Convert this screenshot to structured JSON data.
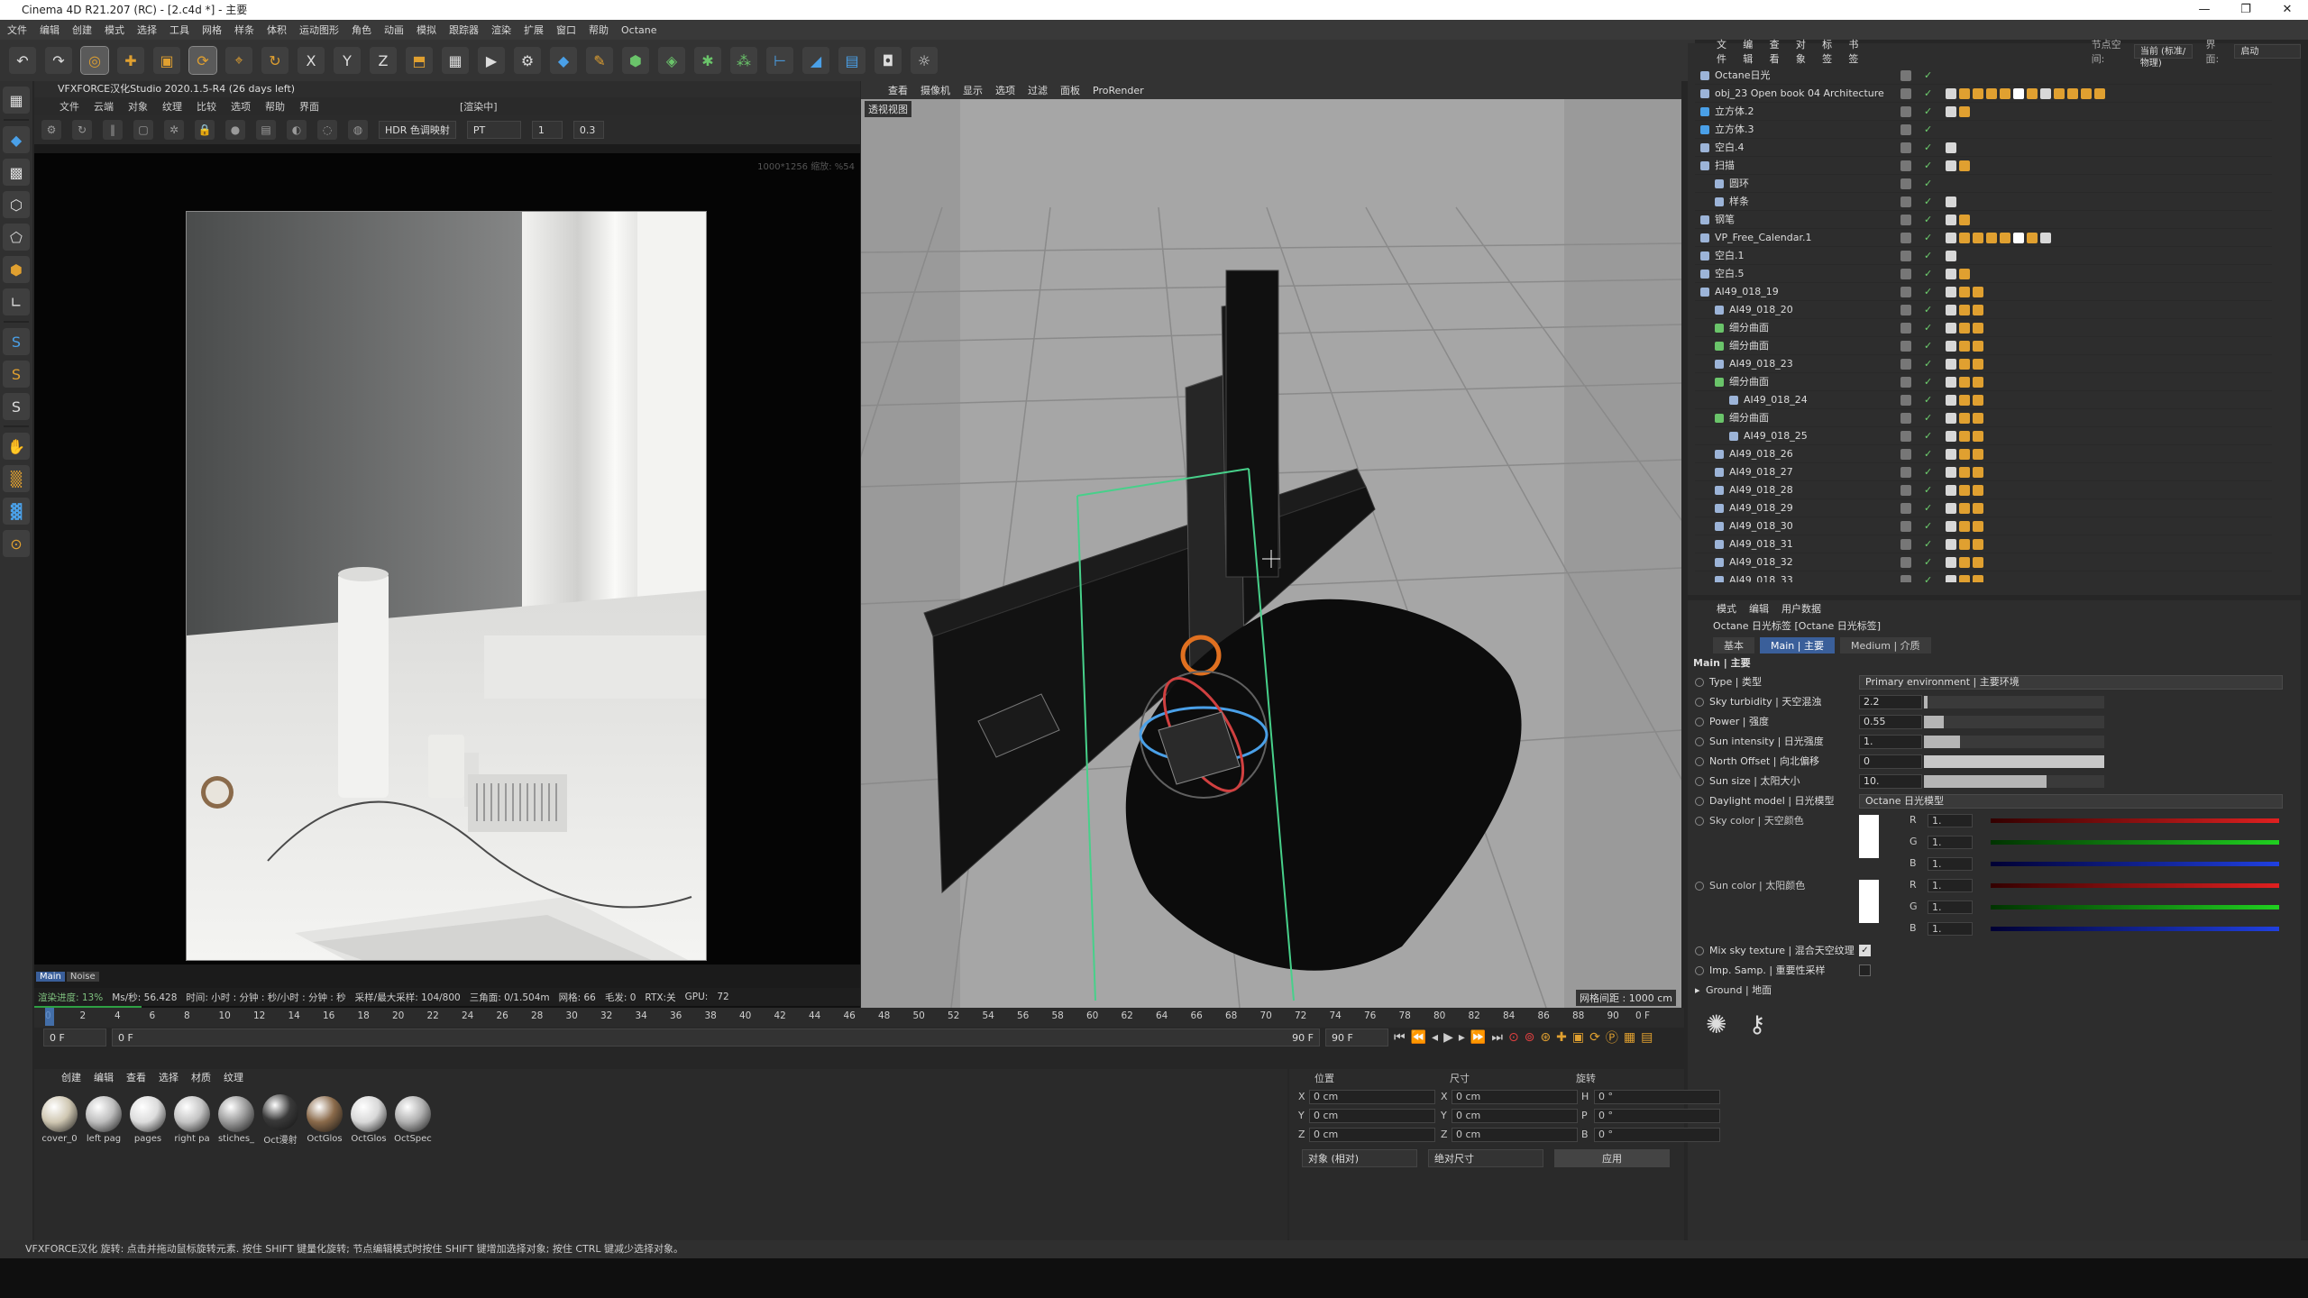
{
  "window": {
    "title": "Cinema 4D R21.207 (RC) - [2.c4d *] - 主要",
    "controls": [
      "—",
      "❐",
      "✕"
    ]
  },
  "menu": [
    "文件",
    "编辑",
    "创建",
    "模式",
    "选择",
    "工具",
    "网格",
    "样条",
    "体积",
    "运动图形",
    "角色",
    "动画",
    "模拟",
    "跟踪器",
    "渲染",
    "扩展",
    "窗口",
    "帮助",
    "Octane"
  ],
  "toolbar": {
    "icons": [
      "undo-icon",
      "redo-icon",
      "move-icon",
      "scale-icon",
      "rotate-icon",
      "select-icon",
      "axis-x-icon",
      "axis-y-icon",
      "axis-z-icon",
      "world-icon",
      "render-region-icon",
      "render-view-icon",
      "render-settings-icon",
      "cube-icon",
      "pen-icon",
      "subdivide-icon",
      "array-icon",
      "cloner-icon",
      "deformer-icon",
      "floor-icon",
      "camera-icon",
      "light-icon"
    ],
    "axis_x": "X",
    "axis_y": "Y",
    "axis_z": "Z"
  },
  "renderer": {
    "title": "VFXFORCE汉化Studio 2020.1.5-R4 (26 days left)",
    "menu": [
      "文件",
      "云端",
      "对象",
      "纹理",
      "比较",
      "选项",
      "帮助",
      "界面"
    ],
    "status_center": "[渲染中]",
    "hdr": "HDR 色调映射",
    "mode": "PT",
    "num1": "1",
    "num2": "0.3",
    "resolution_hint": "1000*1256 缩放: %54",
    "tabs": [
      "Main",
      "Noise"
    ],
    "stats": [
      "渲染进度: 13%",
      "Ms/秒: 56.428",
      "时间: 小时 : 分钟 : 秒/小时 : 分钟 : 秒",
      "采样/最大采样: 104/800",
      "三角面: 0/1.504m",
      "网格: 66",
      "毛发: 0",
      "RTX:关",
      "GPU:",
      "72"
    ],
    "progress": 0.13
  },
  "viewport": {
    "menu": [
      "查看",
      "摄像机",
      "显示",
      "选项",
      "过滤",
      "面板",
      "ProRender"
    ],
    "label": "透视视图",
    "grid_spacing": "网格间距 : 1000 cm"
  },
  "objects": {
    "menu": [
      "文件",
      "编辑",
      "查看",
      "对象",
      "标签",
      "书签"
    ],
    "node_space": "节点空间:",
    "node_value": "当前 (标准/物理)",
    "interface": "界面:",
    "interface_value": "启动",
    "rows": [
      {
        "name": "Octane日光",
        "indent": 0
      },
      {
        "name": "obj_23 Open book 04 Architecture",
        "indent": 0
      },
      {
        "name": "立方体.2",
        "indent": 0
      },
      {
        "name": "立方体.3",
        "indent": 0
      },
      {
        "name": "空白.4",
        "indent": 0
      },
      {
        "name": "扫描",
        "indent": 0
      },
      {
        "name": "圆环",
        "indent": 1
      },
      {
        "name": "样条",
        "indent": 1
      },
      {
        "name": "钢笔",
        "indent": 0
      },
      {
        "name": "VP_Free_Calendar.1",
        "indent": 0
      },
      {
        "name": "空白.1",
        "indent": 0
      },
      {
        "name": "空白.5",
        "indent": 0
      },
      {
        "name": "AI49_018_19",
        "indent": 0
      },
      {
        "name": "AI49_018_20",
        "indent": 1
      },
      {
        "name": "细分曲面",
        "indent": 1
      },
      {
        "name": "细分曲面",
        "indent": 1
      },
      {
        "name": "AI49_018_23",
        "indent": 1
      },
      {
        "name": "细分曲面",
        "indent": 1
      },
      {
        "name": "AI49_018_24",
        "indent": 2
      },
      {
        "name": "细分曲面",
        "indent": 1
      },
      {
        "name": "AI49_018_25",
        "indent": 2
      },
      {
        "name": "AI49_018_26",
        "indent": 1
      },
      {
        "name": "AI49_018_27",
        "indent": 1
      },
      {
        "name": "AI49_018_28",
        "indent": 1
      },
      {
        "name": "AI49_018_29",
        "indent": 1
      },
      {
        "name": "AI49_018_30",
        "indent": 1
      },
      {
        "name": "AI49_018_31",
        "indent": 1
      },
      {
        "name": "AI49_018_32",
        "indent": 1
      },
      {
        "name": "AI49_018_33",
        "indent": 1
      }
    ]
  },
  "attributes": {
    "menu": [
      "模式",
      "编辑",
      "用户数据"
    ],
    "title": "Octane 日光标签 [Octane 日光标签]",
    "tabs": [
      "基本",
      "Main | 主要",
      "Medium | 介质"
    ],
    "section": "Main | 主要",
    "type_label": "Type | 类型",
    "type_value": "Primary environment | 主要环境",
    "params": [
      {
        "label": "Sky turbidity | 天空混浊",
        "value": "2.2",
        "fill": 0.02
      },
      {
        "label": "Power | 强度",
        "value": "0.55",
        "fill": 0.11
      },
      {
        "label": "Sun intensity | 日光强度",
        "value": "1.",
        "fill": 0.2
      },
      {
        "label": "North Offset | 向北偏移",
        "value": "0",
        "fill": 1.0
      },
      {
        "label": "Sun size | 太阳大小",
        "value": "10.",
        "fill": 0.68
      }
    ],
    "daylight_label": "Daylight model | 日光模型",
    "daylight_value": "Octane 日光模型",
    "sky_color": "Sky color | 天空颜色",
    "sun_color": "Sun color | 太阳颜色",
    "rgb": {
      "r": "R",
      "g": "G",
      "b": "B",
      "val": "1."
    },
    "mix_sky": "Mix sky texture | 混合天空纹理",
    "imp_samp": "Imp. Samp. | 重要性采样",
    "ground": "Ground | 地面"
  },
  "timeline": {
    "ticks": [
      "0",
      "2",
      "4",
      "6",
      "8",
      "10",
      "12",
      "14",
      "16",
      "18",
      "20",
      "22",
      "24",
      "26",
      "28",
      "30",
      "32",
      "34",
      "36",
      "38",
      "40",
      "42",
      "44",
      "46",
      "48",
      "50",
      "52",
      "54",
      "56",
      "58",
      "60",
      "62",
      "64",
      "66",
      "68",
      "70",
      "72",
      "74",
      "76",
      "78",
      "80",
      "82",
      "84",
      "86",
      "88",
      "90"
    ],
    "current": "0 F",
    "start": "0 F",
    "end": "90 F",
    "end2": "90 F",
    "frame_right": "0 F"
  },
  "materials": {
    "menu": [
      "创建",
      "编辑",
      "查看",
      "选择",
      "材质",
      "纹理"
    ],
    "items": [
      {
        "name": "cover_0",
        "color": "#cfc7b2"
      },
      {
        "name": "left pag",
        "color": "#bdbdbd"
      },
      {
        "name": "pages",
        "color": "#dcdcdc"
      },
      {
        "name": "right pa",
        "color": "#c4c4c4"
      },
      {
        "name": "stiches_",
        "color": "#9a9a9a"
      },
      {
        "name": "Oct漫射",
        "color": "#3a3a3a"
      },
      {
        "name": "OctGlos",
        "color": "#8a6a4a"
      },
      {
        "name": "OctGlos",
        "color": "#d8d8d8"
      },
      {
        "name": "OctSpec",
        "color": "#b0b0b0"
      }
    ]
  },
  "coords": {
    "headers": [
      "位置",
      "尺寸",
      "旋转"
    ],
    "rows": [
      {
        "a": "X",
        "av": "0 cm",
        "b": "X",
        "bv": "0 cm",
        "c": "H",
        "cv": "0 °"
      },
      {
        "a": "Y",
        "av": "0 cm",
        "b": "Y",
        "bv": "0 cm",
        "c": "P",
        "cv": "0 °"
      },
      {
        "a": "Z",
        "av": "0 cm",
        "b": "Z",
        "bv": "0 cm",
        "c": "B",
        "cv": "0 °"
      }
    ],
    "mode1": "对象 (相对)",
    "mode2": "绝对尺寸",
    "apply": "应用"
  },
  "status": "VFXFORCE汉化    旋转: 点击并拖动鼠标旋转元素. 按住 SHIFT 键量化旋转; 节点编辑模式时按住 SHIFT 键增加选择对象; 按住 CTRL 键减少选择对象。",
  "colors": {
    "accent": "#3a5f9a",
    "green": "#6ed06e",
    "orange": "#e0a030"
  }
}
